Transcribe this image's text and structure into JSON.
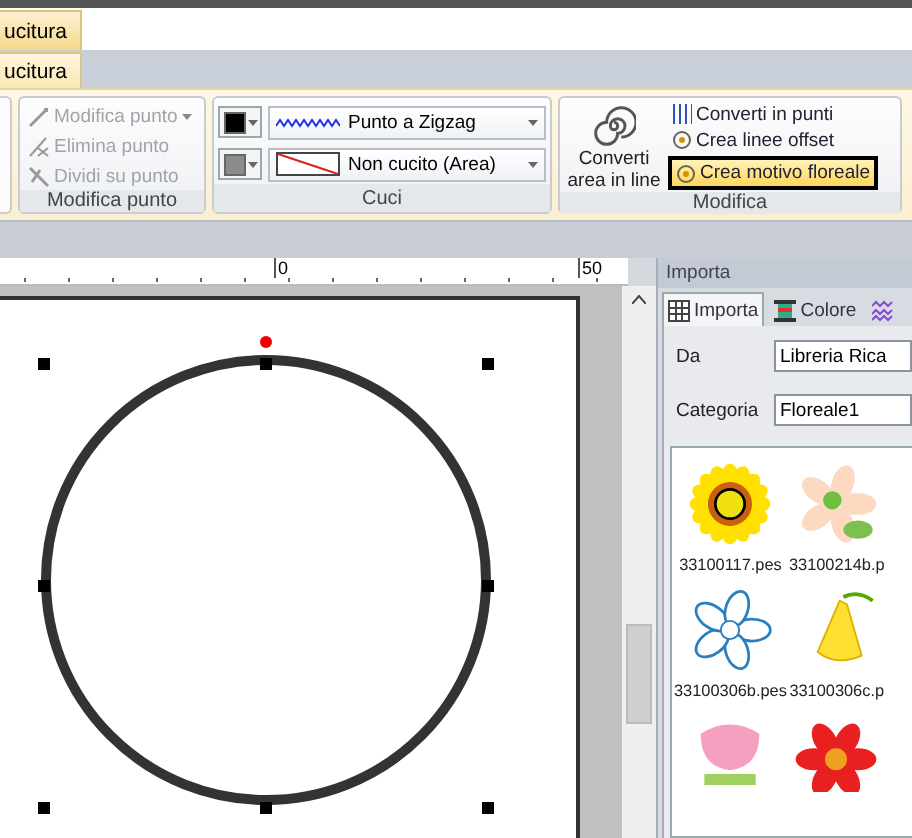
{
  "top_tabs": [
    {
      "label": "ucitura",
      "selected": true
    }
  ],
  "ribbon_tabs": [
    {
      "label": "ucitura",
      "selected": true
    }
  ],
  "groups": [
    {
      "kind": "commands",
      "label": "Modifica punto",
      "items": [
        {
          "label": "Modifica punto",
          "disabled": true
        },
        {
          "label": "Elimina punto",
          "disabled": true
        },
        {
          "label": "Dividi su punto",
          "disabled": true
        }
      ]
    },
    {
      "kind": "stitches",
      "label": "Cuci",
      "rows": [
        {
          "kind": "zigzag",
          "color": "#000000",
          "label": "Punto a Zigzag"
        },
        {
          "kind": "none",
          "color": "#8c8c8c",
          "label": "Non cucito (Area)"
        }
      ]
    },
    {
      "kind": "modify",
      "label": "Modifica",
      "big": {
        "lines": [
          "Converti",
          "area in line"
        ]
      },
      "items": [
        {
          "label": "Converti in punti",
          "highlighted": false
        },
        {
          "label": "Crea linee offset",
          "highlighted": false
        },
        {
          "label": "Crea motivo floreale",
          "highlighted": true
        }
      ]
    }
  ],
  "ruler": {
    "labels": [
      "0",
      "50"
    ]
  },
  "panel": {
    "title": "Importa",
    "tabs": [
      {
        "label": "Importa",
        "selected": true
      },
      {
        "label": "Colore",
        "selected": false
      },
      {
        "selected": false
      }
    ],
    "fields": [
      {
        "label": "Da",
        "value": "Libreria Rica"
      },
      {
        "label": "Categoria",
        "value": "Floreale1"
      }
    ],
    "thumbnails": [
      {
        "kind": "sunflower",
        "file": "33100117.pes"
      },
      {
        "kind": "daisy",
        "file": "33100214b.p"
      },
      {
        "kind": "blue",
        "file": "33100306b.pes"
      },
      {
        "kind": "bell",
        "file": "33100306c.p"
      },
      {
        "kind": "pink"
      },
      {
        "kind": "red"
      }
    ]
  }
}
